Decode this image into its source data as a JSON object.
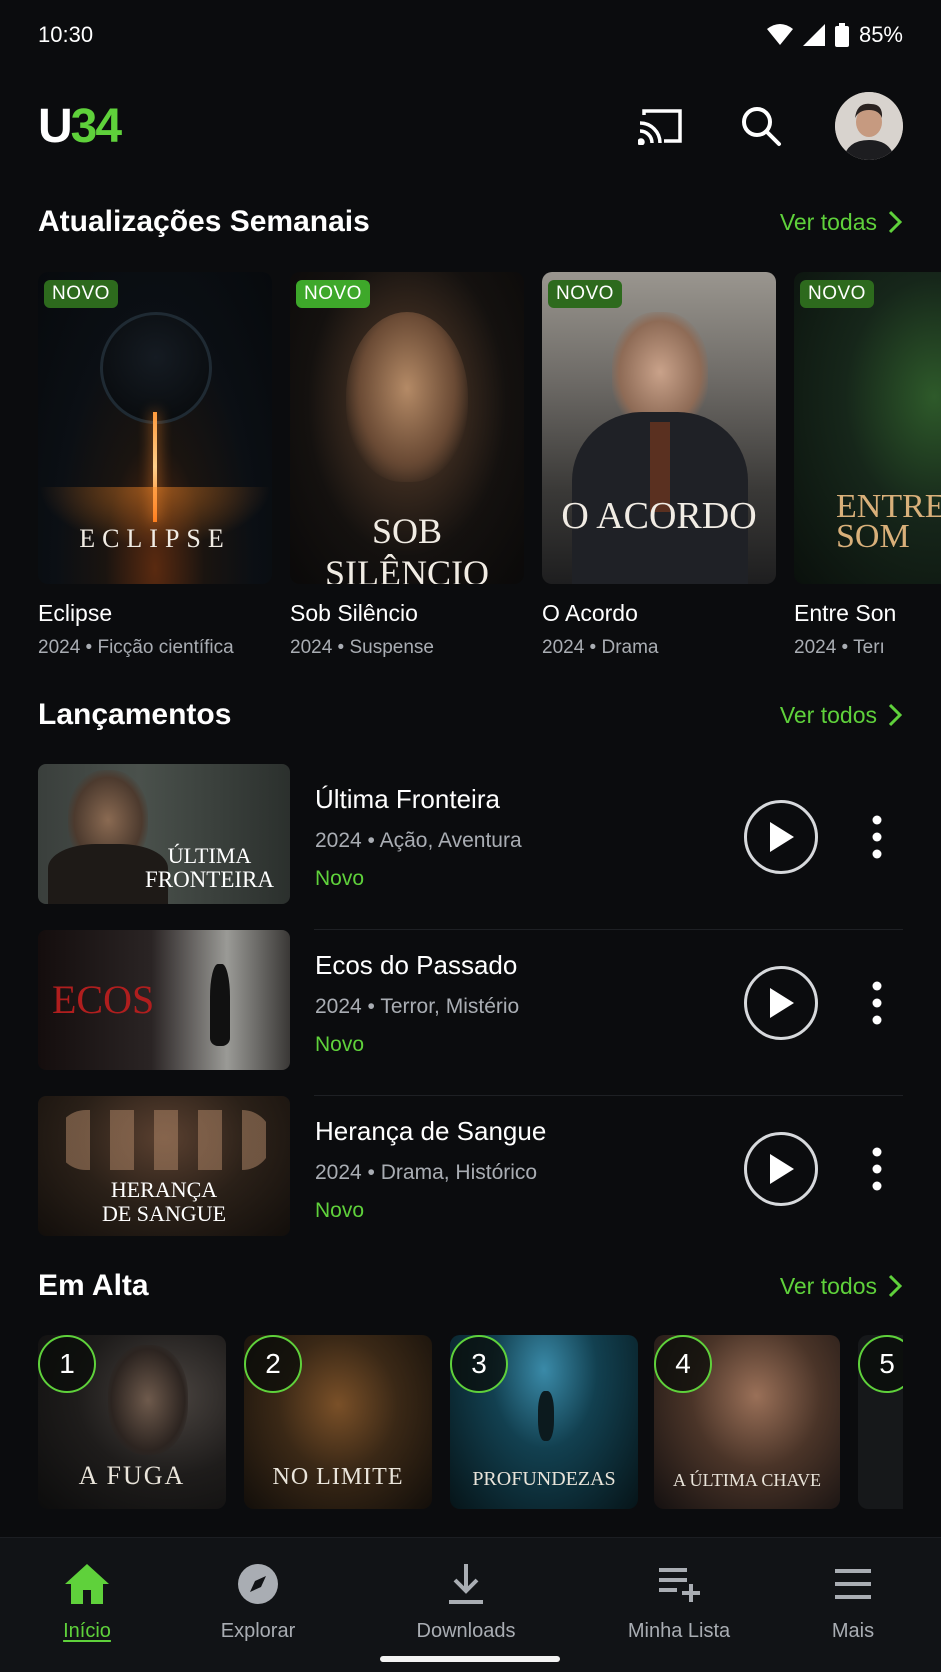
{
  "status_bar": {
    "time": "10:30",
    "battery": "85%"
  },
  "header": {
    "logo_left": "U",
    "logo_right": "34",
    "brand_colors": {
      "white": "#ffffff",
      "green": "#5fd13b"
    }
  },
  "weekly": {
    "title": "Atualizações Semanais",
    "see_all": "Ver todas",
    "badge": "NOVO",
    "items": [
      {
        "poster_text": "ECLIPSE",
        "name": "Eclipse",
        "meta": "2024 • Ficção científica"
      },
      {
        "poster_text": "SOB SILÊNCIO",
        "name": "Sob Silêncio",
        "meta": "2024 • Suspense"
      },
      {
        "poster_text": "O ACORDO",
        "name": "O Acordo",
        "meta": "2024 • Drama"
      },
      {
        "poster_text": "ENTRE SOM",
        "name": "Entre Son",
        "meta": "2024 • Terı"
      }
    ]
  },
  "releases": {
    "title": "Lançamentos",
    "see_all": "Ver todos",
    "items": [
      {
        "thumb_text_1": "ÚLTIMA",
        "thumb_text_2": "FRONTEIRA",
        "title": "Última Fronteira",
        "meta": "2024 • Ação, Aventura",
        "status": "Novo"
      },
      {
        "thumb_text_1": "ECOS",
        "thumb_text_2": "",
        "title": "Ecos do Passado",
        "meta": "2024 • Terror, Mistério",
        "status": "Novo"
      },
      {
        "thumb_text_1": "HERANÇA",
        "thumb_text_2": "DE SANGUE",
        "title": "Herança de Sangue",
        "meta": "2024 • Drama, Histórico",
        "status": "Novo"
      }
    ]
  },
  "trending": {
    "title": "Em Alta",
    "see_all": "Ver todos",
    "items": [
      {
        "rank": "1",
        "poster_text": "A FUGA"
      },
      {
        "rank": "2",
        "poster_text": "NO LIMITE"
      },
      {
        "rank": "3",
        "poster_text": "PROFUNDEZAS"
      },
      {
        "rank": "4",
        "poster_text": "A ÚLTIMA CHAVE"
      },
      {
        "rank": "5",
        "poster_text": ""
      }
    ]
  },
  "bottom_nav": [
    {
      "label": "Início",
      "icon": "home-icon",
      "active": true
    },
    {
      "label": "Explorar",
      "icon": "compass-icon",
      "active": false
    },
    {
      "label": "Downloads",
      "icon": "download-icon",
      "active": false
    },
    {
      "label": "Minha Lista",
      "icon": "playlist-add-icon",
      "active": false
    },
    {
      "label": "Mais",
      "icon": "menu-icon",
      "active": false
    }
  ],
  "colors": {
    "background": "#0b0c0e",
    "accent": "#5fd13b",
    "muted_text": "#a9adb3"
  }
}
